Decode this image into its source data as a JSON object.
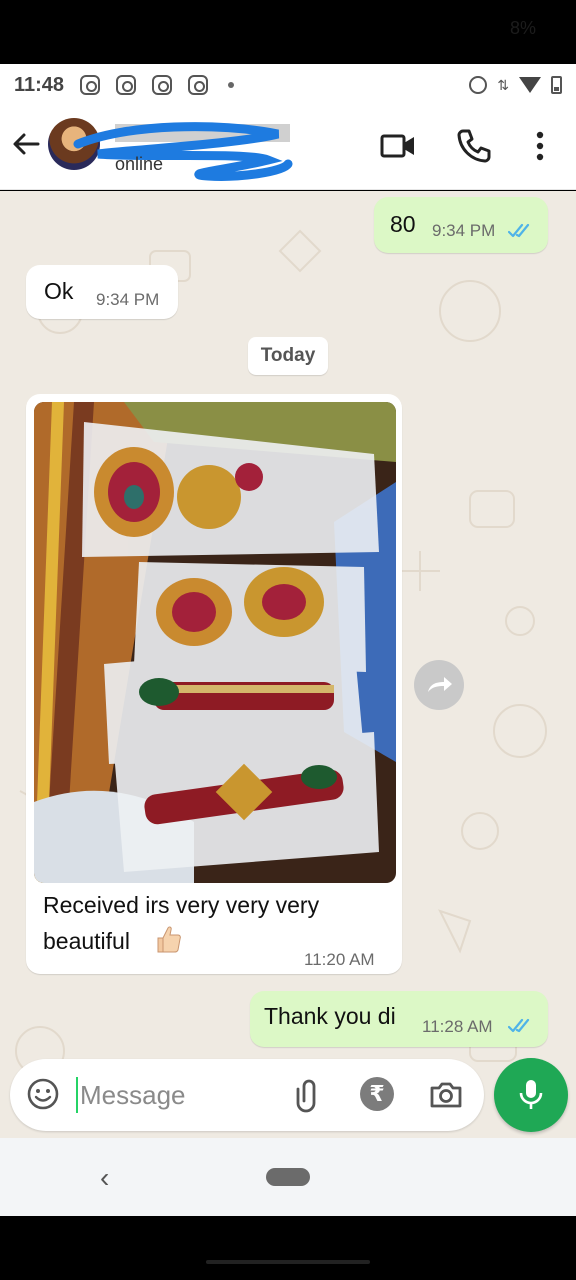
{
  "status_bar": {
    "battery_percent": "8%",
    "time": "11:48",
    "notification_icons": [
      "instagram-icon",
      "instagram-icon",
      "instagram-icon",
      "instagram-icon"
    ],
    "right_icons": [
      "alarm-icon",
      "data-arrows-icon",
      "wifi-icon",
      "battery-icon"
    ]
  },
  "header": {
    "contact_status": "online",
    "icons": [
      "back-arrow-icon",
      "video-call-icon",
      "voice-call-icon",
      "more-options-icon"
    ]
  },
  "messages": [
    {
      "direction": "outgoing",
      "text": "80",
      "time": "9:34 PM",
      "status": "read"
    },
    {
      "direction": "incoming",
      "text": "Ok",
      "time": "9:34 PM"
    },
    {
      "type": "date-separator",
      "text": "Today"
    },
    {
      "direction": "incoming",
      "type": "image",
      "caption_line1": "Received  irs very very very",
      "caption_line2": "beautiful",
      "emoji": "thumbs-up",
      "time": "11:20 AM"
    },
    {
      "direction": "outgoing",
      "text": "Thank you di",
      "time": "11:28 AM",
      "status": "read"
    }
  ],
  "composer": {
    "placeholder": "Message",
    "icons": [
      "emoji-icon",
      "attach-icon",
      "rupee-payment-icon",
      "camera-icon",
      "mic-icon"
    ]
  },
  "nav_bar": {
    "back_glyph": "‹"
  },
  "colors": {
    "outgoing_bubble": "#dcf8c6",
    "incoming_bubble": "#ffffff",
    "chat_background": "#efeae2",
    "accent_green": "#1fa855",
    "read_ticks": "#4fb3e8"
  }
}
